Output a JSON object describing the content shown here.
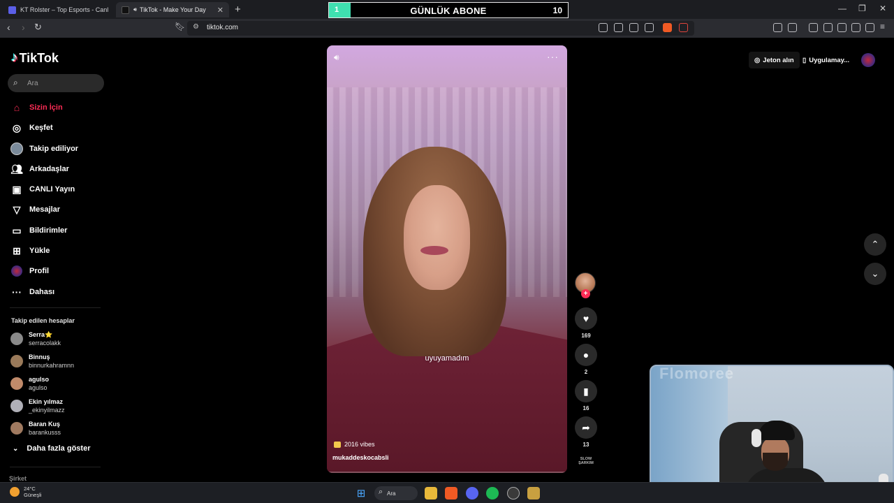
{
  "browser": {
    "tabs": [
      {
        "label": "KT Rolster – Top Esports - Canlı Sonu",
        "active": false
      },
      {
        "label": "TikTok - Make Your Day",
        "active": true
      }
    ],
    "address": "tiktok.com"
  },
  "overlay": {
    "start_value": "1",
    "title": "GÜNLÜK ABONE",
    "end_value": "10",
    "progress": 0.09,
    "accent": "#3fe0b0"
  },
  "tiktok": {
    "logo": "TikTok",
    "search_placeholder": "Ara",
    "nav": [
      {
        "label": "Sizin İçin",
        "icon": "home-icon",
        "active": true
      },
      {
        "label": "Keşfet",
        "icon": "compass-icon"
      },
      {
        "label": "Takip ediliyor",
        "icon": "following-avatar-icon"
      },
      {
        "label": "Arkadaşlar",
        "icon": "friends-icon"
      },
      {
        "label": "CANLI Yayın",
        "icon": "live-icon"
      },
      {
        "label": "Mesajlar",
        "icon": "messages-icon"
      },
      {
        "label": "Bildirimler",
        "icon": "notifications-icon"
      },
      {
        "label": "Yükle",
        "icon": "upload-icon"
      },
      {
        "label": "Profil",
        "icon": "profile-icon"
      },
      {
        "label": "Dahası",
        "icon": "more-icon"
      }
    ],
    "following_title": "Takip edilen hesaplar",
    "following": [
      {
        "name": "Serra⭐",
        "handle": "serracolakk"
      },
      {
        "name": "Binnuş",
        "handle": "binnurkahramnn"
      },
      {
        "name": "agulso",
        "handle": "agulso"
      },
      {
        "name": "Ekin yılmaz",
        "handle": "_ekinyilmazz"
      },
      {
        "name": "Baran Kuş",
        "handle": "barankusss"
      }
    ],
    "show_more": "Daha fazla göster",
    "company": "Şirket",
    "coins_button": "Jeton alın",
    "app_button": "Uygulamay...",
    "brand_color": "#fe2c55"
  },
  "video": {
    "caption": "uyuyamadım",
    "sound_tag": "2016 vibes",
    "author": "mukaddeskocabsli",
    "likes": "169",
    "comments": "2",
    "saves": "16",
    "shares": "13",
    "music_label": "SLOW ŞARKIM"
  },
  "webcam": {
    "watermark": "Flomoree"
  },
  "taskbar": {
    "temperature": "24°C",
    "weather": "Güneşli",
    "search": "Ara"
  }
}
